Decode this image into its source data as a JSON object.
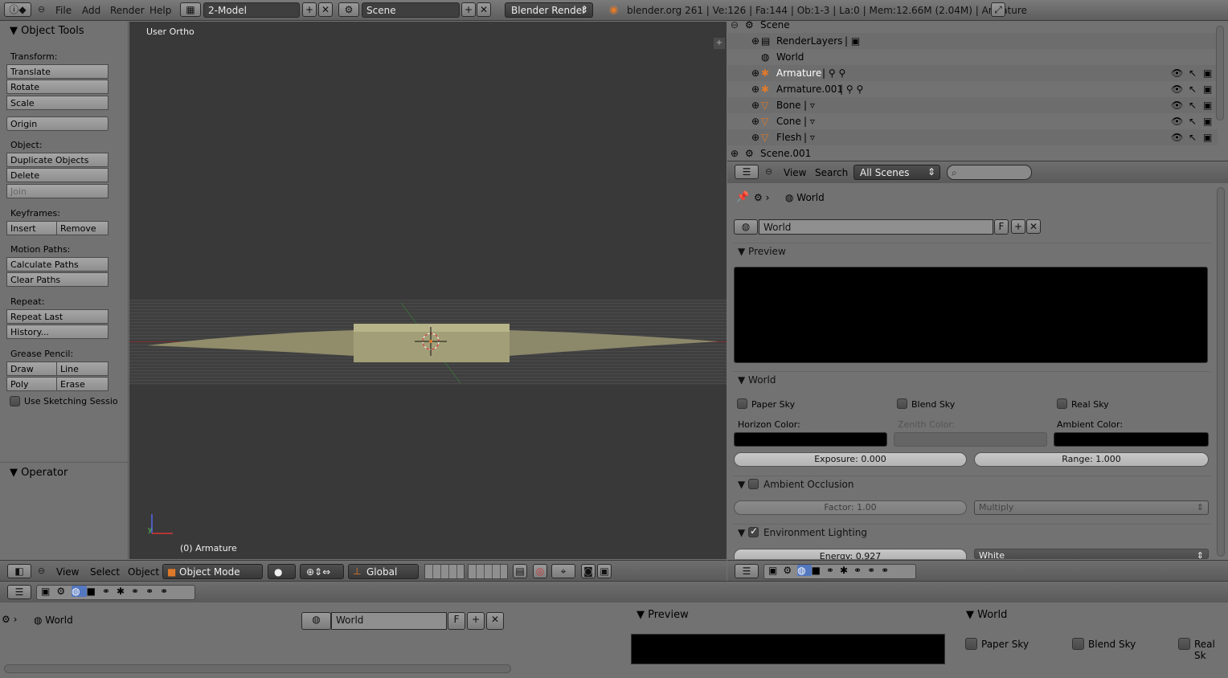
{
  "topbar": {
    "menus": [
      "File",
      "Add",
      "Render",
      "Help"
    ],
    "screen": "2-Model",
    "scene": "Scene",
    "engine": "Blender Render",
    "stats": "blender.org 261 | Ve:126 | Fa:144 | Ob:1-3 | La:0 | Mem:12.66M (2.04M) | Armature"
  },
  "tools": {
    "title": "Object Tools",
    "transform_label": "Transform:",
    "translate": "Translate",
    "rotate": "Rotate",
    "scale": "Scale",
    "origin": "Origin",
    "object_label": "Object:",
    "duplicate": "Duplicate Objects",
    "delete": "Delete",
    "join": "Join",
    "keyframes_label": "Keyframes:",
    "insert": "Insert",
    "remove": "Remove",
    "motion_label": "Motion Paths:",
    "calc_paths": "Calculate Paths",
    "clear_paths": "Clear Paths",
    "repeat_label": "Repeat:",
    "repeat_last": "Repeat Last",
    "history": "History...",
    "grease_label": "Grease Pencil:",
    "draw": "Draw",
    "line": "Line",
    "poly": "Poly",
    "erase": "Erase",
    "sketch": "Use Sketching Sessio",
    "operator": "Operator"
  },
  "viewport": {
    "view_name": "User Ortho",
    "object_name": "(0) Armature"
  },
  "view_header": {
    "view": "View",
    "select": "Select",
    "object": "Object",
    "mode": "Object Mode",
    "orientation": "Global"
  },
  "outliner": {
    "rows": [
      {
        "name": "Scene"
      },
      {
        "name": "RenderLayers"
      },
      {
        "name": "World"
      },
      {
        "name": "Armature"
      },
      {
        "name": "Armature.001"
      },
      {
        "name": "Bone"
      },
      {
        "name": "Cone"
      },
      {
        "name": "Flesh"
      },
      {
        "name": "Scene.001"
      }
    ],
    "view": "View",
    "search": "Search",
    "filter": "All Scenes"
  },
  "props": {
    "breadcrumb": "World",
    "world_name": "World",
    "fake": "F",
    "preview": "Preview",
    "world_panel": "World",
    "paper_sky": "Paper Sky",
    "blend_sky": "Blend Sky",
    "real_sky": "Real Sky",
    "horizon": "Horizon Color:",
    "zenith": "Zenith Color:",
    "ambient": "Ambient Color:",
    "exposure": "Exposure: 0.000",
    "range": "Range: 1.000",
    "ao": "Ambient Occlusion",
    "factor": "Factor: 1.00",
    "multiply": "Multiply",
    "env": "Environment Lighting",
    "energy": "Energy: 0.927",
    "white": "White"
  },
  "bottom": {
    "breadcrumb": "World",
    "world_name": "World",
    "fake": "F",
    "preview": "Preview",
    "world_panel": "World",
    "paper_sky": "Paper Sky",
    "blend_sky": "Blend Sky",
    "real_sky": "Real Sk"
  },
  "colors": {
    "accent_orange": "#e07a2a",
    "viewport_bg": "#393939",
    "panel_bg": "#727272"
  }
}
